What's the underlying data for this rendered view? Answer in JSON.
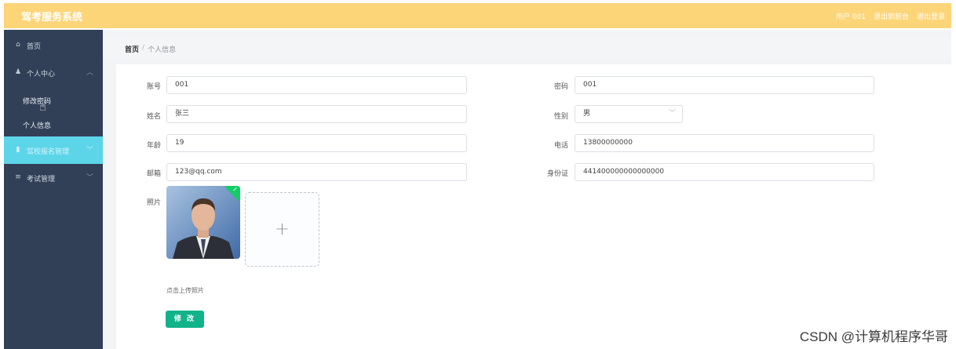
{
  "app": {
    "title": "驾考服务系统"
  },
  "header": {
    "user": "用户 001",
    "back_to_front": "退出到前台",
    "logout": "退出登录"
  },
  "sidebar": {
    "items": [
      {
        "label": "首页",
        "icon": "home-icon"
      },
      {
        "label": "个人中心",
        "icon": "user-icon"
      },
      {
        "label": "修改密码"
      },
      {
        "label": "个人信息"
      },
      {
        "label": "驾校报名管理",
        "icon": "trash-icon"
      },
      {
        "label": "考试管理",
        "icon": "menu-icon"
      }
    ]
  },
  "breadcrumb": {
    "home": "首页",
    "separator": "/",
    "current": "个人信息"
  },
  "form": {
    "account_label": "账号",
    "account_value": "001",
    "password_label": "密码",
    "password_value": "001",
    "name_label": "姓名",
    "name_value": "张三",
    "gender_label": "性别",
    "gender_value": "男",
    "age_label": "年龄",
    "age_value": "19",
    "phone_label": "电话",
    "phone_value": "13800000000",
    "email_label": "邮箱",
    "email_value": "123@qq.com",
    "idcard_label": "身份证",
    "idcard_value": "441400000000000000",
    "photo_label": "照片",
    "upload_hint": "点击上传照片",
    "submit_label": "修 改"
  },
  "watermark": "CSDN @计算机程序华哥",
  "colors": {
    "topbar": "#fdd579",
    "sidebar": "#324057",
    "active": "#5dd5e9",
    "button": "#13b38a"
  }
}
